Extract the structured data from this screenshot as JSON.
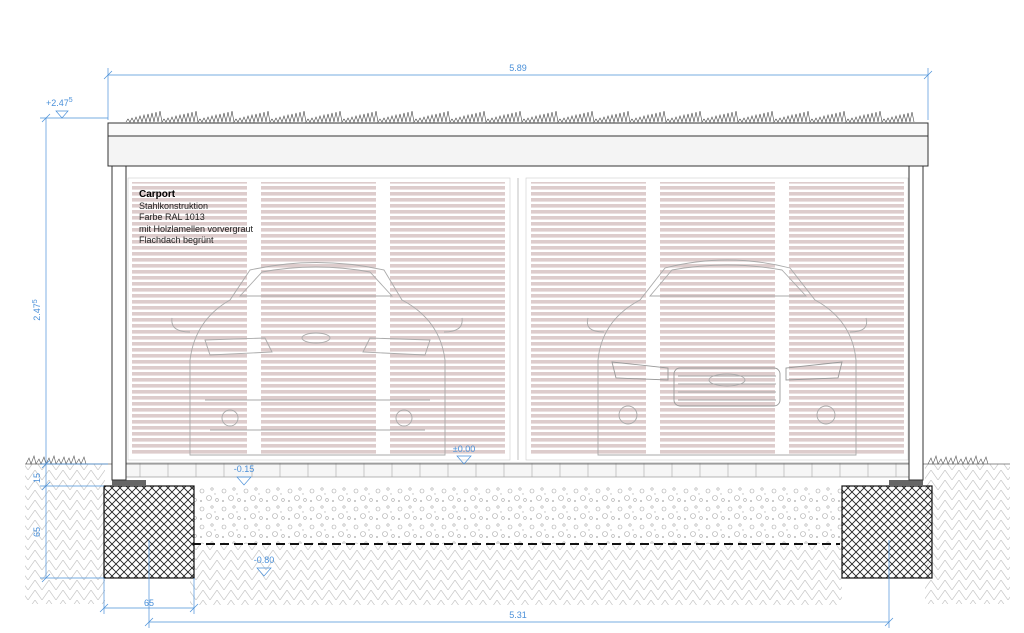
{
  "title": "Carport",
  "notes": [
    "Stahlkonstruktion",
    "Farbe RAL 1013",
    "mit Holzlamellen vorvergraut",
    "Flachdach begrünt"
  ],
  "dimensions": {
    "overall_width": "5.89",
    "post_spacing": "5.31",
    "foundation_width": "65",
    "height": "2.47",
    "height_sup": "5",
    "foundation_depth": "65",
    "plinth_height": "15"
  },
  "levels": {
    "top": "+2.47",
    "top_sup": "5",
    "ground": "±0.00",
    "under_slab": "-0.15",
    "foundation_bottom": "-0.80"
  },
  "colors": {
    "dimension": "#4a90d9",
    "lines": "#333333",
    "slats": "#d9c9c9"
  }
}
